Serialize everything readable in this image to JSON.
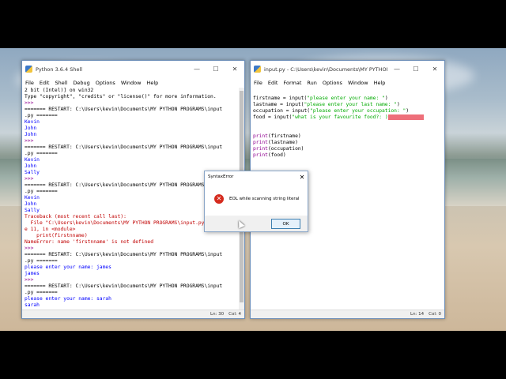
{
  "shell": {
    "title": "Python 3.6.4 Shell",
    "menu": [
      "File",
      "Edit",
      "Shell",
      "Debug",
      "Options",
      "Window",
      "Help"
    ],
    "lines": [
      {
        "t": "2 bit (Intel)] on win32",
        "c": "black"
      },
      {
        "t": "Type \"copyright\", \"credits\" or \"license()\" for more information.",
        "c": "black"
      },
      {
        "t": ">>> ",
        "c": "purple"
      },
      {
        "t": "======= RESTART: C:\\Users\\kevin\\Documents\\MY PYTHON PROGRAMS\\input",
        "c": "black"
      },
      {
        "t": ".py =======",
        "c": "black"
      },
      {
        "t": "Kevin",
        "c": "blue"
      },
      {
        "t": "John",
        "c": "blue"
      },
      {
        "t": "John",
        "c": "blue"
      },
      {
        "t": ">>> ",
        "c": "purple"
      },
      {
        "t": "======= RESTART: C:\\Users\\kevin\\Documents\\MY PYTHON PROGRAMS\\input",
        "c": "black"
      },
      {
        "t": ".py =======",
        "c": "black"
      },
      {
        "t": "Kevin",
        "c": "blue"
      },
      {
        "t": "John",
        "c": "blue"
      },
      {
        "t": "Sally",
        "c": "blue"
      },
      {
        "t": ">>> ",
        "c": "purple"
      },
      {
        "t": "======= RESTART: C:\\Users\\kevin\\Documents\\MY PYTHON PROGRAMS\\input",
        "c": "black"
      },
      {
        "t": ".py =======",
        "c": "black"
      },
      {
        "t": "Kevin",
        "c": "blue"
      },
      {
        "t": "John",
        "c": "blue"
      },
      {
        "t": "Sally",
        "c": "blue"
      },
      {
        "t": "Traceback (most recent call last):",
        "c": "red"
      },
      {
        "t": "  File \"C:\\Users\\kevin\\Documents\\MY PYTHON PROGRAMS\\input.py\", lin",
        "c": "red"
      },
      {
        "t": "e 11, in <module>",
        "c": "red"
      },
      {
        "t": "    print(firstnname)",
        "c": "red"
      },
      {
        "t": "NameError: name 'firstnname' is not defined",
        "c": "red"
      },
      {
        "t": ">>> ",
        "c": "purple"
      },
      {
        "t": "======= RESTART: C:\\Users\\kevin\\Documents\\MY PYTHON PROGRAMS\\input",
        "c": "black"
      },
      {
        "t": ".py =======",
        "c": "black"
      },
      {
        "t": "please enter your name: james",
        "c": "blue"
      },
      {
        "t": "james",
        "c": "blue"
      },
      {
        "t": ">>> ",
        "c": "purple"
      },
      {
        "t": "======= RESTART: C:\\Users\\kevin\\Documents\\MY PYTHON PROGRAMS\\input",
        "c": "black"
      },
      {
        "t": ".py =======",
        "c": "black"
      },
      {
        "t": "please enter your name: sarah",
        "c": "blue"
      },
      {
        "t": "sarah",
        "c": "blue"
      },
      {
        "t": ">>> ",
        "c": "purple"
      }
    ],
    "status": {
      "ln": "Ln: 30",
      "col": "Col: 4"
    }
  },
  "editor": {
    "title": "input.py - C:\\Users\\kevin\\Documents\\MY PYTHON PROGRA...",
    "menu": [
      "File",
      "Edit",
      "Format",
      "Run",
      "Options",
      "Window",
      "Help"
    ],
    "lines": [
      [
        {
          "t": "firstname = input(",
          "c": "black"
        },
        {
          "t": "\"please enter your name: \"",
          "c": "green"
        },
        {
          "t": ")",
          "c": "black"
        }
      ],
      [
        {
          "t": "lastname = input(",
          "c": "black"
        },
        {
          "t": "\"please enter your last name: \"",
          "c": "green"
        },
        {
          "t": ")",
          "c": "black"
        }
      ],
      [
        {
          "t": "occupation = input(",
          "c": "black"
        },
        {
          "t": "\"please enter your occupation: \"",
          "c": "green"
        },
        {
          "t": ")",
          "c": "black"
        }
      ],
      [
        {
          "t": "food = input(",
          "c": "black"
        },
        {
          "t": "\"what is your favourite food?: )",
          "c": "green"
        },
        {
          "t": "            ",
          "c": "hl"
        }
      ],
      [
        {
          "t": "",
          "c": "black"
        }
      ],
      [
        {
          "t": "",
          "c": "black"
        }
      ],
      [
        {
          "t": "print",
          "c": "purple"
        },
        {
          "t": "(firstname)",
          "c": "black"
        }
      ],
      [
        {
          "t": "print",
          "c": "purple"
        },
        {
          "t": "(lastname)",
          "c": "black"
        }
      ],
      [
        {
          "t": "print",
          "c": "purple"
        },
        {
          "t": "(occupation)",
          "c": "black"
        }
      ],
      [
        {
          "t": "print",
          "c": "purple"
        },
        {
          "t": "(food)",
          "c": "black"
        }
      ]
    ],
    "status": {
      "ln": "Ln: 14",
      "col": "Col: 0"
    }
  },
  "dialog": {
    "title": "SyntaxError",
    "message": "EOL while scanning string literal",
    "ok_label": "OK",
    "icon": "error-icon"
  },
  "window_buttons": {
    "minimize": "—",
    "maximize": "☐",
    "close": "✕"
  }
}
